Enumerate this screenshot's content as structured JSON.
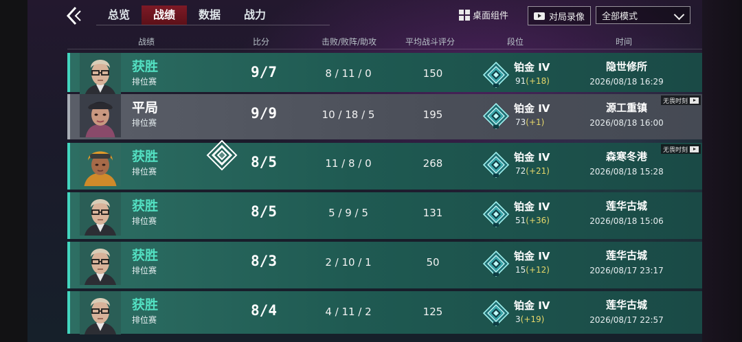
{
  "nav": {
    "tabs": [
      {
        "label": "总览",
        "active": false
      },
      {
        "label": "战绩",
        "active": true
      },
      {
        "label": "数据",
        "active": false
      },
      {
        "label": "战力",
        "active": false
      }
    ],
    "widget_label": "桌面组件",
    "replay_label": "对局录像",
    "mode_select_value": "全部模式"
  },
  "columns": {
    "record": "战绩",
    "score": "比分",
    "kda": "击败/败阵/助攻",
    "rating": "平均战斗评分",
    "rank": "段位",
    "time": "时间"
  },
  "colors": {
    "win_accent": "#53e0c2",
    "delta": "#e7d86a",
    "active_tab": "#7d1a26"
  },
  "matches": [
    {
      "result": "获胜",
      "type": "排位赛",
      "score": "9/7",
      "kda": "8 / 11 / 0",
      "rating": "150",
      "rank": "铂金 IV",
      "rank_points": "91",
      "rank_delta": "(+18)",
      "map": "隐世修所",
      "time": "2026/08/18 16:29",
      "moment": "",
      "avatar": "agent-glasses"
    },
    {
      "result": "平局",
      "type": "排位赛",
      "score": "9/9",
      "kda": "10 / 18 / 5",
      "rating": "195",
      "rank": "铂金 IV",
      "rank_points": "73",
      "rank_delta": "(+1)",
      "map": "源工重镇",
      "time": "2026/08/18 16:00",
      "moment": "无畏时刻",
      "avatar": "agent-cap"
    },
    {
      "result": "获胜",
      "type": "排位赛",
      "score": "8/5",
      "kda": "11 / 8 / 0",
      "rating": "268",
      "rank": "铂金 IV",
      "rank_points": "72",
      "rank_delta": "(+21)",
      "map": "森寒冬港",
      "time": "2026/08/18 15:28",
      "moment": "无畏时刻",
      "avatar": "agent-goggles"
    },
    {
      "result": "获胜",
      "type": "排位赛",
      "score": "8/5",
      "kda": "5 / 9 / 5",
      "rating": "131",
      "rank": "铂金 IV",
      "rank_points": "51",
      "rank_delta": "(+36)",
      "map": "莲华古城",
      "time": "2026/08/18 15:06",
      "moment": "",
      "avatar": "agent-glasses"
    },
    {
      "result": "获胜",
      "type": "排位赛",
      "score": "8/3",
      "kda": "2 / 10 / 1",
      "rating": "50",
      "rank": "铂金 IV",
      "rank_points": "15",
      "rank_delta": "(+12)",
      "map": "莲华古城",
      "time": "2026/08/17 23:17",
      "moment": "",
      "avatar": "agent-glasses"
    },
    {
      "result": "获胜",
      "type": "排位赛",
      "score": "8/4",
      "kda": "4 / 11 / 2",
      "rating": "125",
      "rank": "铂金 IV",
      "rank_points": "3",
      "rank_delta": "(+19)",
      "map": "莲华古城",
      "time": "2026/08/17 22:57",
      "moment": "",
      "avatar": "agent-glasses"
    }
  ]
}
